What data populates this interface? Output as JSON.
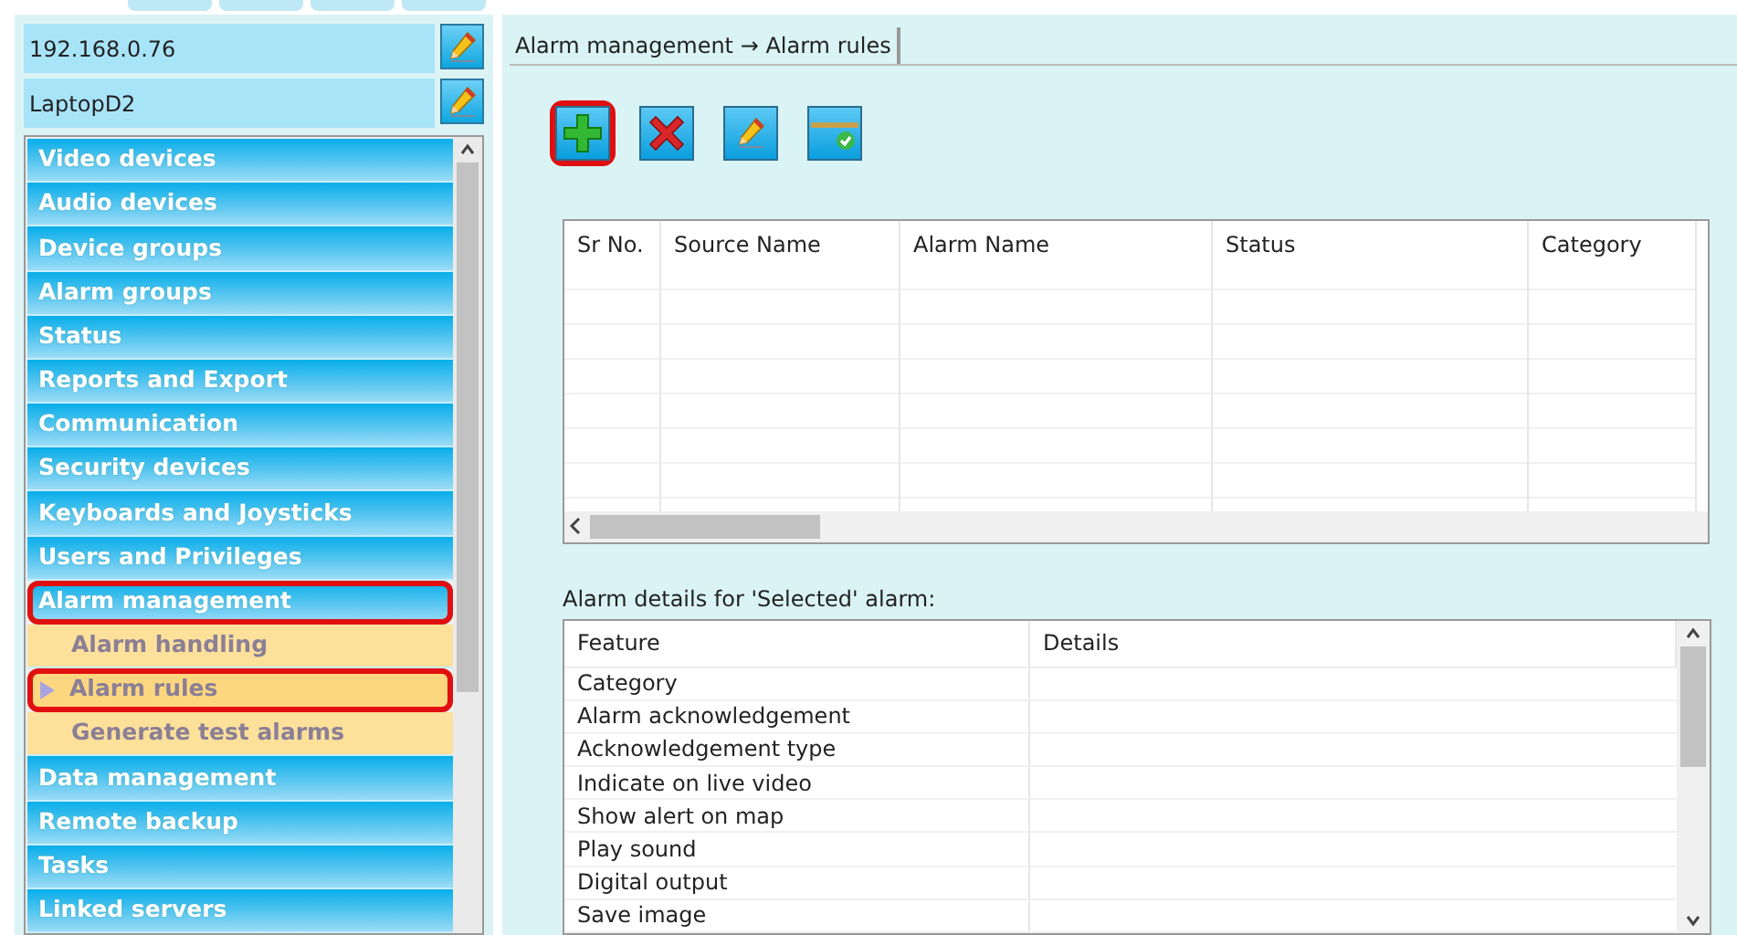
{
  "connection": {
    "server": "192.168.0.76",
    "computer": "LaptopD2"
  },
  "nav": [
    {
      "label": "Video devices",
      "selected": false,
      "annotated": false
    },
    {
      "label": "Audio devices",
      "selected": false,
      "annotated": false
    },
    {
      "label": "Device groups",
      "selected": false,
      "annotated": false
    },
    {
      "label": "Alarm groups",
      "selected": false,
      "annotated": false
    },
    {
      "label": "Status",
      "selected": false,
      "annotated": false
    },
    {
      "label": "Reports and Export",
      "selected": false,
      "annotated": false
    },
    {
      "label": "Communication",
      "selected": false,
      "annotated": false
    },
    {
      "label": "Security devices",
      "selected": false,
      "annotated": false
    },
    {
      "label": "Keyboards and Joysticks",
      "selected": false,
      "annotated": false
    },
    {
      "label": "Users and Privileges",
      "selected": false,
      "annotated": false
    },
    {
      "label": "Alarm management",
      "selected": false,
      "annotated": true,
      "children": [
        {
          "label": "Alarm handling",
          "selected": false,
          "annotated": false
        },
        {
          "label": "Alarm rules",
          "selected": true,
          "annotated": true
        },
        {
          "label": "Generate test alarms",
          "selected": false,
          "annotated": false
        }
      ]
    },
    {
      "label": "Data management",
      "selected": false,
      "annotated": false
    },
    {
      "label": "Remote backup",
      "selected": false,
      "annotated": false
    },
    {
      "label": "Tasks",
      "selected": false,
      "annotated": false
    },
    {
      "label": "Linked servers",
      "selected": false,
      "annotated": false
    }
  ],
  "tab": {
    "label": "Alarm management → Alarm rules"
  },
  "toolbar": [
    {
      "kind": "add",
      "annotated": true
    },
    {
      "kind": "delete",
      "annotated": false
    },
    {
      "kind": "edit",
      "annotated": false
    },
    {
      "kind": "apply",
      "annotated": false
    }
  ],
  "rules_table": {
    "columns": [
      "Sr No.",
      "Source Name",
      "Alarm Name",
      "Status",
      "Category"
    ]
  },
  "details": {
    "title": "Alarm details for 'Selected' alarm:",
    "columns": [
      "Feature",
      "Details"
    ],
    "rows": [
      "Category",
      "Alarm acknowledgement",
      "Acknowledgement type",
      "Indicate on live video",
      "Show alert on map",
      "Play sound",
      "Digital output",
      "Save image"
    ]
  }
}
